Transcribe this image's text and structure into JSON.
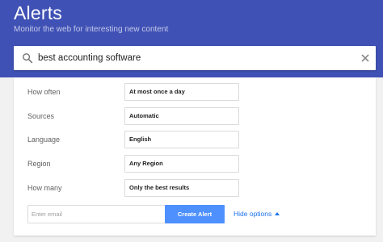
{
  "header": {
    "title": "Alerts",
    "subtitle": "Monitor the web for interesting new content",
    "background_color": "#3f51b5"
  },
  "search": {
    "value": "best accounting software",
    "search_icon": "search-icon",
    "clear_icon": "close-icon"
  },
  "options": [
    {
      "label": "How often",
      "value": "At most once a day"
    },
    {
      "label": "Sources",
      "value": "Automatic"
    },
    {
      "label": "Language",
      "value": "English"
    },
    {
      "label": "Region",
      "value": "Any Region"
    },
    {
      "label": "How many",
      "value": "Only the best results"
    }
  ],
  "email": {
    "placeholder": "Enter email"
  },
  "create_button": {
    "label": "Create Alert",
    "color": "#4d90fe"
  },
  "hide_options": {
    "label": "Hide options",
    "icon": "caret-up-icon",
    "color": "#1a73e8"
  }
}
